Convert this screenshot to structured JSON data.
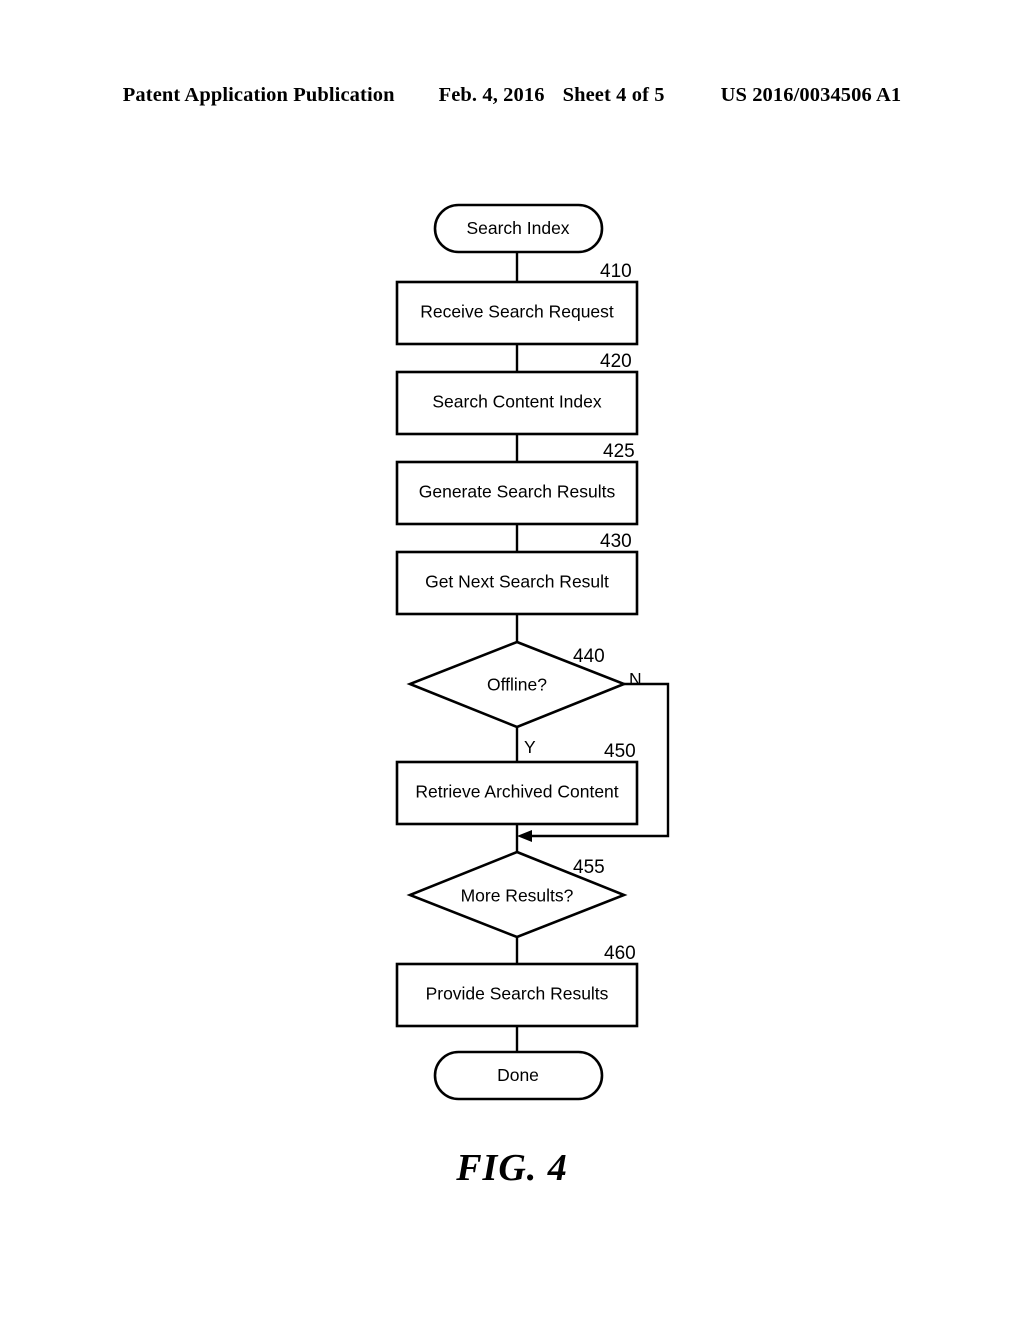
{
  "header": {
    "publication": "Patent Application Publication",
    "date": "Feb. 4, 2016",
    "sheet": "Sheet 4 of 5",
    "patent_number": "US 2016/0034506 A1"
  },
  "figure": {
    "caption": "FIG. 4",
    "nodes": {
      "start": {
        "label": "Search Index",
        "type": "terminator"
      },
      "n410": {
        "label": "Receive Search Request",
        "ref": "410",
        "type": "process"
      },
      "n420": {
        "label": "Search Content Index",
        "ref": "420",
        "type": "process"
      },
      "n425": {
        "label": "Generate Search Results",
        "ref": "425",
        "type": "process"
      },
      "n430": {
        "label": "Get Next Search Result",
        "ref": "430",
        "type": "process"
      },
      "n440": {
        "label": "Offline?",
        "ref": "440",
        "type": "decision"
      },
      "n450": {
        "label": "Retrieve Archived Content",
        "ref": "450",
        "type": "process"
      },
      "n455": {
        "label": "More Results?",
        "ref": "455",
        "type": "decision"
      },
      "n460": {
        "label": "Provide Search Results",
        "ref": "460",
        "type": "process"
      },
      "end": {
        "label": "Done",
        "type": "terminator"
      }
    },
    "branches": {
      "offline_no": "N",
      "offline_yes": "Y"
    }
  }
}
